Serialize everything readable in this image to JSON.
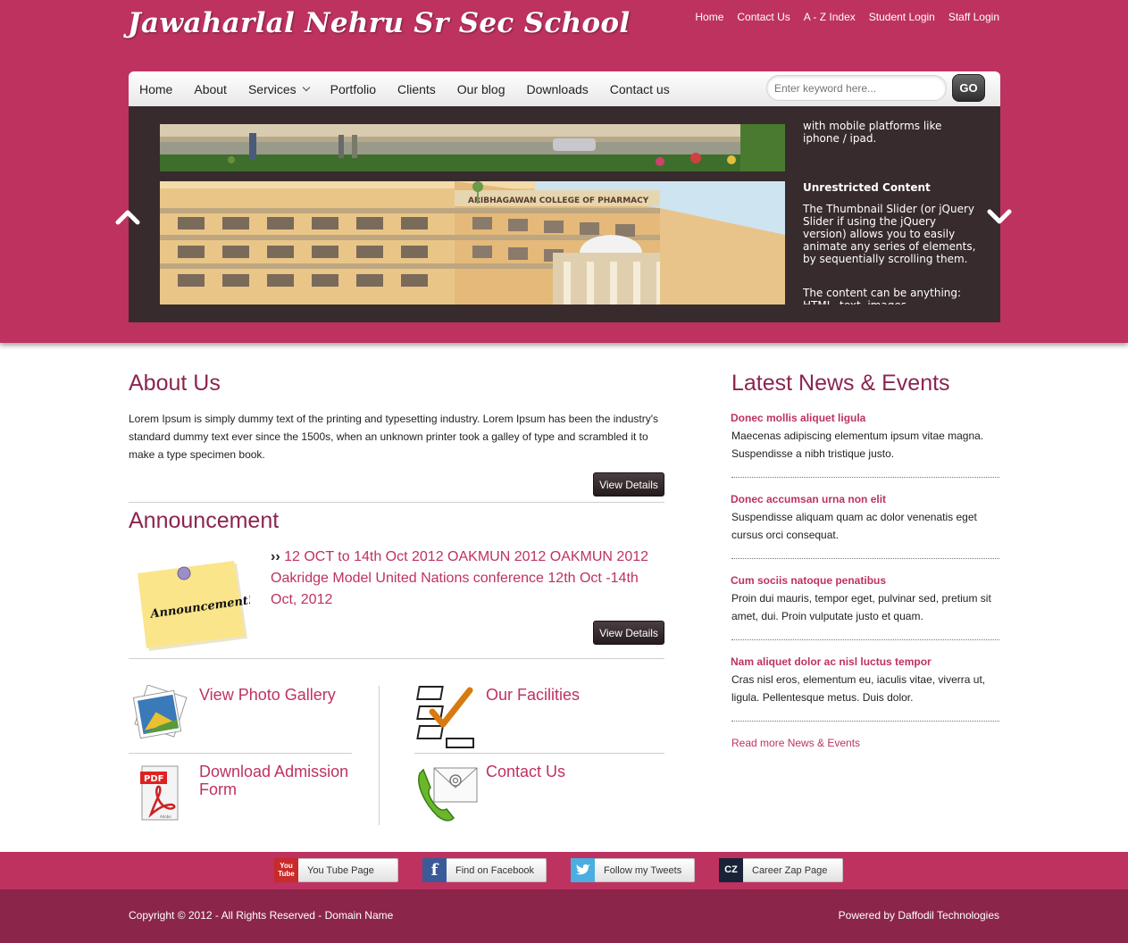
{
  "site": {
    "title": "Jawaharlal Nehru Sr Sec School"
  },
  "top_links": [
    "Home",
    "Contact Us",
    "A - Z Index",
    "Student Login",
    "Staff Login"
  ],
  "nav": {
    "items": [
      "Home",
      "About",
      "Services",
      "Portfolio",
      "Clients",
      "Our blog",
      "Downloads",
      "Contact us"
    ],
    "search_placeholder": "Enter keyword here...",
    "go_label": "GO"
  },
  "slider": {
    "top_text": "with mobile platforms like iphone / ipad.",
    "building_sign": "ARIBHAGAWAN COLLEGE OF PHARMACY",
    "heading": "Unrestricted Content",
    "body": "The Thumbnail Slider (or jQuery Slider if using the jQuery version) allows you to easily animate any series of elements, by sequentially scrolling them.",
    "body2": "The content can be anything: HTML, text, images"
  },
  "about": {
    "title": "About Us",
    "text": "Lorem Ipsum is simply dummy text of the printing and typesetting industry. Lorem Ipsum has been the industry's standard dummy text ever since the 1500s, when an unknown printer took a galley of type and scrambled it to make a type specimen book.",
    "button": "View Details"
  },
  "announcement": {
    "title": "Announcement",
    "note_text": "Announcement!",
    "marker": "››",
    "text": "12 OCT to 14th Oct 2012 OAKMUN 2012 OAKMUN 2012 Oakridge Model United Nations conference 12th Oct -14th Oct, 2012",
    "button": "View Details"
  },
  "features": {
    "gallery": "View Photo Gallery",
    "facilities": "Our Facilities",
    "admission": "Download Admission Form",
    "contact": "Contact Us",
    "pdf_label": "PDF",
    "pdf_sublabel": "Adobe"
  },
  "news": {
    "title": "Latest News & Events",
    "items": [
      {
        "title": "Donec mollis aliquet ligula",
        "body": "Maecenas adipiscing elementum ipsum vitae magna. Suspendisse a nibh tristique justo."
      },
      {
        "title": "Donec accumsan urna non elit",
        "body": "Suspendisse aliquam quam ac dolor venenatis eget cursus orci consequat."
      },
      {
        "title": "Cum sociis natoque penatibus",
        "body": "Proin dui mauris, tempor eget, pulvinar sed, pretium sit amet, dui. Proin vulputate justo et quam."
      },
      {
        "title": "Nam aliquet dolor ac nisl luctus tempor",
        "body": "Cras nisl eros, elementum eu, iaculis vitae, viverra ut, ligula. Pellentesque metus. Duis dolor."
      }
    ],
    "read_more": "Read more News & Events"
  },
  "social": {
    "youtube": "You Tube Page",
    "youtube_icon": "You Tube",
    "facebook": "Find on Facebook",
    "twitter": "Follow my Tweets",
    "careerzap": "Career Zap Page",
    "careerzap_icon": "CZ"
  },
  "footer": {
    "copyright": "Copyright © 2012 - All Rights Reserved - Domain Name",
    "powered": "Powered by Daffodil Technologies"
  },
  "colors": {
    "brand": "#be3260",
    "footer": "#8b2549",
    "slider_bg": "#372b2e",
    "heading": "#8b2550"
  }
}
